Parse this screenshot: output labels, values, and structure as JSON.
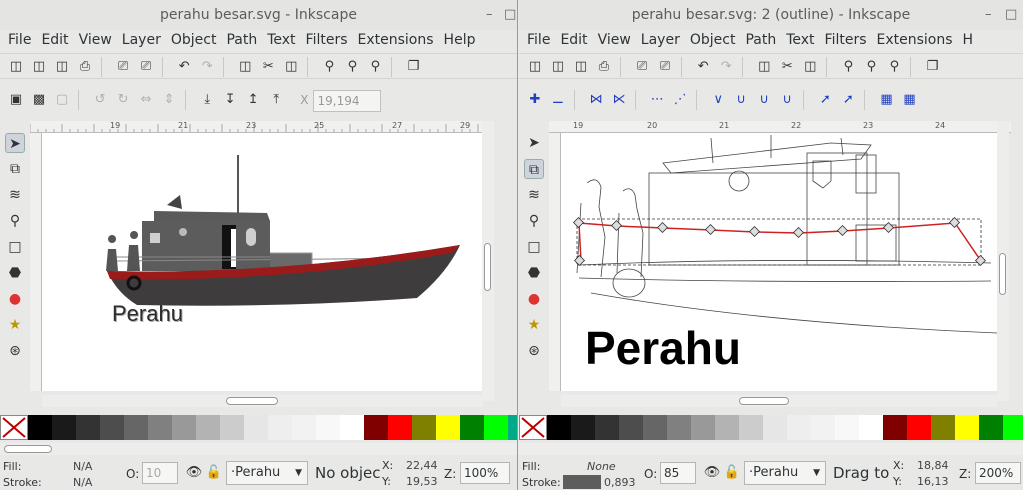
{
  "left": {
    "title": "perahu besar.svg - Inkscape",
    "menu": [
      "File",
      "Edit",
      "View",
      "Layer",
      "Object",
      "Path",
      "Text",
      "Filters",
      "Extensions",
      "Help"
    ],
    "x_label": "X",
    "x_value": "19,194",
    "ruler_labels": [
      "19",
      "21",
      "23",
      "25",
      "27",
      "29"
    ],
    "canvas_text": "Perahu",
    "status": {
      "fill_label": "Fill:",
      "fill_value": "N/A",
      "stroke_label": "Stroke:",
      "stroke_value": "N/A",
      "opacity_label": "O:",
      "opacity_value": "10",
      "layer": "·Perahu",
      "message": "No objec",
      "x_label": "X:",
      "x_value": "22,44",
      "y_label": "Y:",
      "y_value": "19,53",
      "zoom_label": "Z:",
      "zoom_value": "100%"
    }
  },
  "right": {
    "title": "perahu besar.svg: 2 (outline) - Inkscape",
    "menu": [
      "File",
      "Edit",
      "View",
      "Layer",
      "Object",
      "Path",
      "Text",
      "Filters",
      "Extensions",
      "H"
    ],
    "ruler_labels": [
      "19",
      "20",
      "21",
      "22",
      "23",
      "24"
    ],
    "canvas_text": "Perahu",
    "status": {
      "fill_label": "Fill:",
      "fill_value": "None",
      "stroke_label": "Stroke:",
      "stroke_value": "0,893",
      "opacity_label": "O:",
      "opacity_value": "85",
      "layer": "·Perahu",
      "message": "Drag to",
      "x_label": "X:",
      "x_value": "18,84",
      "y_label": "Y:",
      "y_value": "16,13",
      "zoom_label": "Z:",
      "zoom_value": "200%"
    }
  },
  "palette": [
    "#000000",
    "#1a1a1a",
    "#333333",
    "#4d4d4d",
    "#666666",
    "#808080",
    "#999999",
    "#b3b3b3",
    "#cccccc",
    "#e6e6e6",
    "#eeeeee",
    "#f2f2f2",
    "#f8f8f8",
    "#ffffff",
    "#800000",
    "#ff0000",
    "#808000",
    "#ffff00",
    "#008000",
    "#00ff00",
    "#00aa88"
  ],
  "colors": {
    "hull_red": "#9b1b1b",
    "hull_dark": "#3d3b3c",
    "cabin": "#5a5a5a",
    "path_red": "#cc2222"
  }
}
